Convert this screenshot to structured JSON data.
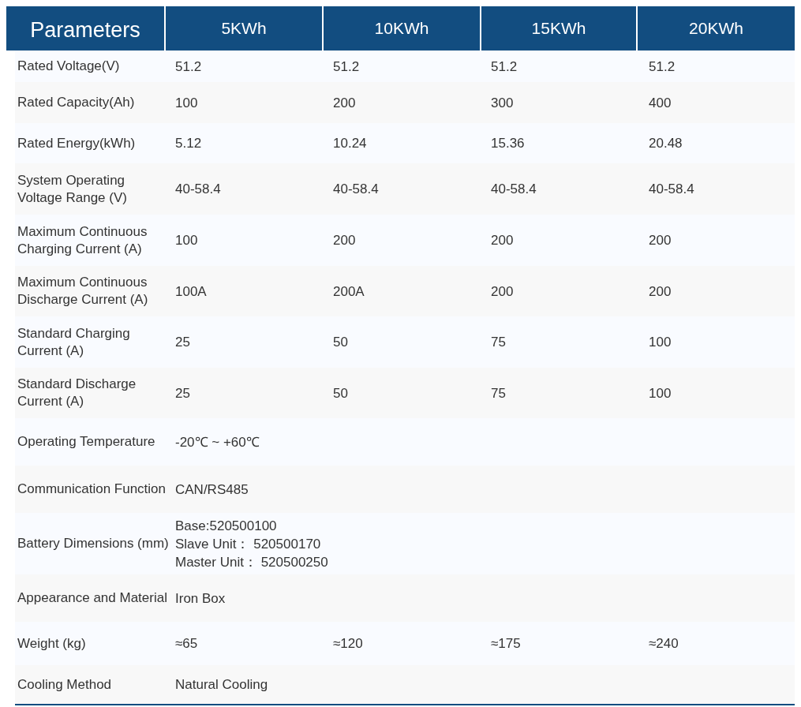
{
  "table": {
    "columns": [
      "Parameters",
      "5KWh",
      "10KWh",
      "15KWh",
      "20KWh"
    ],
    "rows": [
      {
        "label": "Rated Voltage(V)",
        "values": [
          "51.2",
          "51.2",
          "51.2",
          "51.2"
        ]
      },
      {
        "label": "Rated Capacity(Ah)",
        "values": [
          "100",
          "200",
          "300",
          "400"
        ]
      },
      {
        "label": "Rated Energy(kWh)",
        "values": [
          "5.12",
          "10.24",
          "15.36",
          "20.48"
        ]
      },
      {
        "label": "System Operating Voltage Range (V)",
        "values": [
          "40-58.4",
          "40-58.4",
          "40-58.4",
          "40-58.4"
        ]
      },
      {
        "label": "Maximum Continuous Charging Current (A)",
        "values": [
          "100",
          "200",
          "200",
          "200"
        ]
      },
      {
        "label": "Maximum Continuous Discharge Current (A)",
        "values": [
          "100A",
          "200A",
          "200",
          "200"
        ]
      },
      {
        "label": "Standard Charging Current (A)",
        "values": [
          "25",
          "50",
          "75",
          "100"
        ]
      },
      {
        "label": "Standard Discharge Current (A)",
        "values": [
          "25",
          "50",
          "75",
          "100"
        ]
      },
      {
        "label": "Operating Temperature",
        "values": [
          "-20℃ ~ +60℃"
        ]
      },
      {
        "label": "Communication Function",
        "values": [
          "CAN/RS485"
        ]
      },
      {
        "label": "Battery Dimensions (mm)",
        "values": [
          "Base:520500100\nSlave Unit： 520500170\nMaster Unit： 520500250"
        ]
      },
      {
        "label": "Appearance and Material",
        "values": [
          "Iron Box"
        ]
      },
      {
        "label": "Weight (kg)",
        "values": [
          "≈65",
          "≈120",
          "≈175",
          "≈240"
        ]
      },
      {
        "label": "Cooling Method",
        "values": [
          "Natural Cooling"
        ]
      }
    ]
  }
}
